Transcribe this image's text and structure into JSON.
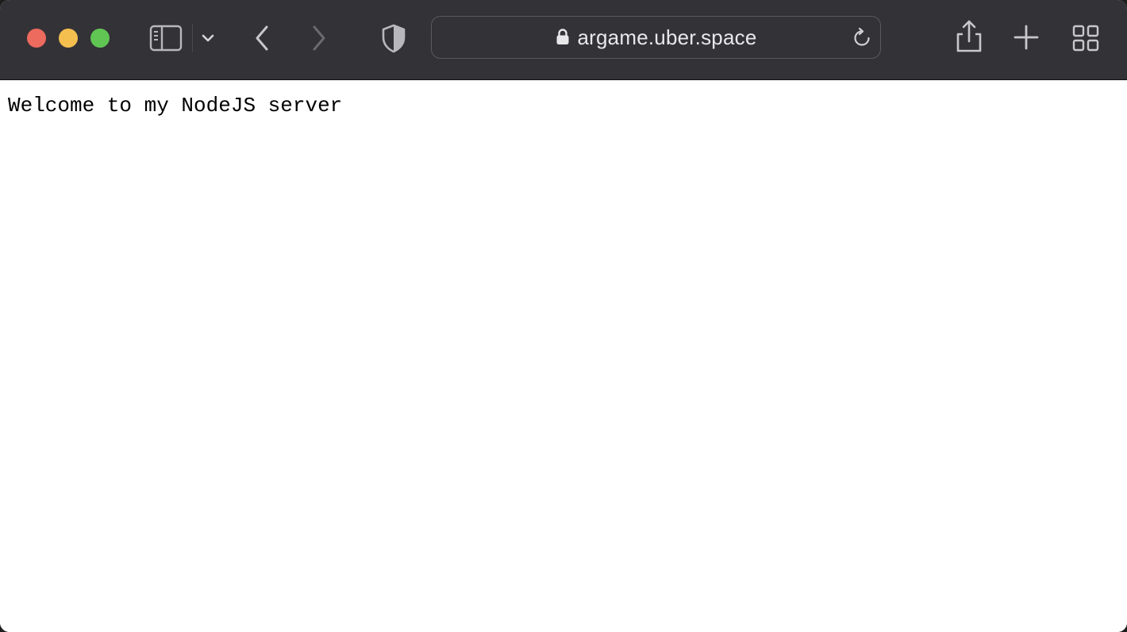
{
  "browser": {
    "toolbar_color": "#333237",
    "window_controls": {
      "close_color": "#ed6a5e",
      "minimize_color": "#f5bf4f",
      "maximize_color": "#61c554"
    },
    "icons": {
      "sidebar": "sidebar-icon",
      "sidebar_menu": "chevron-down-icon",
      "back": "chevron-left-icon",
      "forward": "chevron-right-icon",
      "privacy": "shield-icon",
      "lock": "lock-icon",
      "reload": "reload-icon",
      "share": "share-icon",
      "new_tab": "plus-icon",
      "tab_overview": "grid-icon"
    },
    "address_bar": {
      "url": "argame.uber.space"
    }
  },
  "page": {
    "body_text": "Welcome to my NodeJS server"
  }
}
